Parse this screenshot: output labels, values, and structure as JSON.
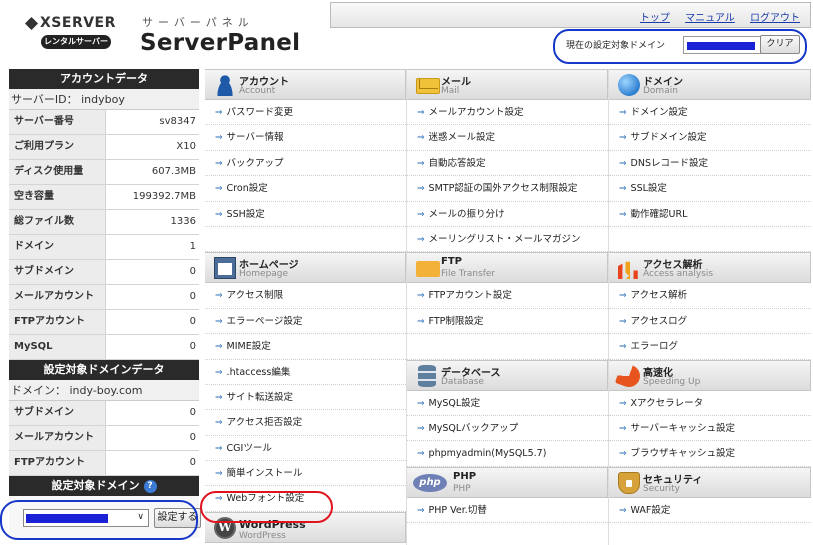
{
  "header": {
    "brand": "XSERVER",
    "rental_badge": "レンタルサーバー",
    "kana": "サーバーパネル",
    "panel_title": "ServerPanel",
    "links": [
      "トップ",
      "マニュアル",
      "ログアウト"
    ],
    "domain_label": "現在の設定対象ドメイン",
    "domain_value": "",
    "clear_label": "クリア"
  },
  "account": {
    "title": "アカウントデータ",
    "server_id": "サーバーID： indyboy",
    "rows": [
      {
        "k": "サーバー番号",
        "v": "sv8347"
      },
      {
        "k": "ご利用プラン",
        "v": "X10"
      },
      {
        "k": "ディスク使用量",
        "v": "607.3MB"
      },
      {
        "k": "空き容量",
        "v": "199392.7MB"
      },
      {
        "k": "総ファイル数",
        "v": "1336"
      },
      {
        "k": "ドメイン",
        "v": "1"
      },
      {
        "k": "サブドメイン",
        "v": "0"
      },
      {
        "k": "メールアカウント",
        "v": "0"
      },
      {
        "k": "FTPアカウント",
        "v": "0"
      },
      {
        "k": "MySQL",
        "v": "0"
      }
    ]
  },
  "domain_data": {
    "title": "設定対象ドメインデータ",
    "domain_line": "ドメイン： indy-boy.com",
    "rows": [
      {
        "k": "サブドメイン",
        "v": "0"
      },
      {
        "k": "メールアカウント",
        "v": "0"
      },
      {
        "k": "FTPアカウント",
        "v": "0"
      }
    ]
  },
  "target": {
    "title": "設定対象ドメイン",
    "help": "?",
    "select_value": "",
    "caret": "∨",
    "button": "設定する"
  },
  "grid": {
    "arrow": "⇒",
    "col1": {
      "account": {
        "ja": "アカウント",
        "en": "Account",
        "icon": "person-icon",
        "items": [
          "パスワード変更",
          "サーバー情報",
          "バックアップ",
          "Cron設定",
          "SSH設定"
        ]
      },
      "homepage": {
        "ja": "ホームページ",
        "en": "Homepage",
        "icon": "window-icon",
        "items": [
          "アクセス制限",
          "エラーページ設定",
          "MIME設定",
          ".htaccess編集",
          "サイト転送設定",
          "アクセス拒否設定",
          "CGIツール",
          "簡単インストール",
          "Webフォント設定"
        ]
      },
      "wordpress": {
        "ja": "WordPress",
        "en": "WordPress",
        "icon": "wordpress-icon"
      }
    },
    "col2": {
      "mail": {
        "ja": "メール",
        "en": "Mail",
        "icon": "mail-icon",
        "items": [
          "メールアカウント設定",
          "迷惑メール設定",
          "自動応答設定",
          "SMTP認証の国外アクセス制限設定",
          "メールの振り分け",
          "メーリングリスト・メールマガジン"
        ]
      },
      "ftp": {
        "ja": "FTP",
        "en": "File Transfer",
        "icon": "folder-icon",
        "items": [
          "FTPアカウント設定",
          "FTP制限設定"
        ]
      },
      "database": {
        "ja": "データベース",
        "en": "Database",
        "icon": "database-icon",
        "items": [
          "MySQL設定",
          "MySQLバックアップ",
          "phpmyadmin(MySQL5.7)"
        ]
      },
      "php": {
        "ja": "PHP",
        "en": "PHP",
        "icon": "php-icon",
        "icon_text": "php",
        "items": [
          "PHP Ver.切替"
        ]
      }
    },
    "col3": {
      "domain": {
        "ja": "ドメイン",
        "en": "Domain",
        "icon": "globe-icon",
        "items": [
          "ドメイン設定",
          "サブドメイン設定",
          "DNSレコード設定",
          "SSL設定",
          "動作確認URL"
        ]
      },
      "access": {
        "ja": "アクセス解析",
        "en": "Access analysis",
        "icon": "chart-icon",
        "items": [
          "アクセス解析",
          "アクセスログ",
          "エラーログ"
        ]
      },
      "speed": {
        "ja": "高速化",
        "en": "Speeding Up",
        "icon": "speed-icon",
        "items": [
          "Xアクセラレータ",
          "サーバーキャッシュ設定",
          "ブラウザキャッシュ設定"
        ]
      },
      "security": {
        "ja": "セキュリティ",
        "en": "Security",
        "icon": "shield-icon",
        "items": [
          "WAF設定"
        ]
      }
    }
  },
  "colors": {
    "accent_blue": "#1637c9",
    "highlight_red": "#e0141e",
    "mask_blue": "#1b22d6"
  }
}
